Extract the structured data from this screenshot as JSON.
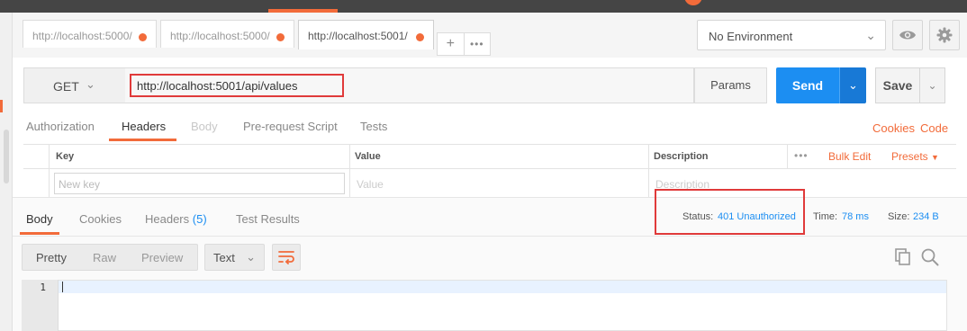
{
  "tabs": [
    {
      "url": "http://localhost:5000/",
      "has_changes": true
    },
    {
      "url": "http://localhost:5000/",
      "has_changes": true
    },
    {
      "url": "http://localhost:5001/",
      "has_changes": true
    }
  ],
  "tab_actions": {
    "add": "+",
    "more": "•••"
  },
  "environment": {
    "selected": "No Environment"
  },
  "request": {
    "method": "GET",
    "url": "http://localhost:5001/api/values",
    "params_label": "Params",
    "send_label": "Send",
    "save_label": "Save"
  },
  "request_tabs": [
    {
      "label": "Authorization",
      "state": "normal"
    },
    {
      "label": "Headers",
      "state": "active"
    },
    {
      "label": "Body",
      "state": "disabled"
    },
    {
      "label": "Pre-request Script",
      "state": "normal"
    },
    {
      "label": "Tests",
      "state": "normal"
    }
  ],
  "request_links": {
    "cookies": "Cookies",
    "code": "Code"
  },
  "headers_table": {
    "columns": {
      "key": "Key",
      "value": "Value",
      "description": "Description"
    },
    "bulk_edit": "Bulk Edit",
    "presets": "Presets",
    "row_placeholders": {
      "key": "New key",
      "value": "Value",
      "description": "Description"
    }
  },
  "response_tabs": [
    {
      "label": "Body"
    },
    {
      "label": "Cookies"
    },
    {
      "label": "Headers",
      "count": "(5)"
    },
    {
      "label": "Test Results"
    }
  ],
  "response_meta": {
    "status_label": "Status:",
    "status_value": "401 Unauthorized",
    "time_label": "Time:",
    "time_value": "78 ms",
    "size_label": "Size:",
    "size_value": "234 B"
  },
  "view_modes": [
    "Pretty",
    "Raw",
    "Preview"
  ],
  "format": "Text",
  "editor": {
    "line_numbers": [
      "1"
    ]
  },
  "colors": {
    "accent": "#f26b3a",
    "primary": "#1c8ef2",
    "highlight_box": "#e03a3a"
  }
}
